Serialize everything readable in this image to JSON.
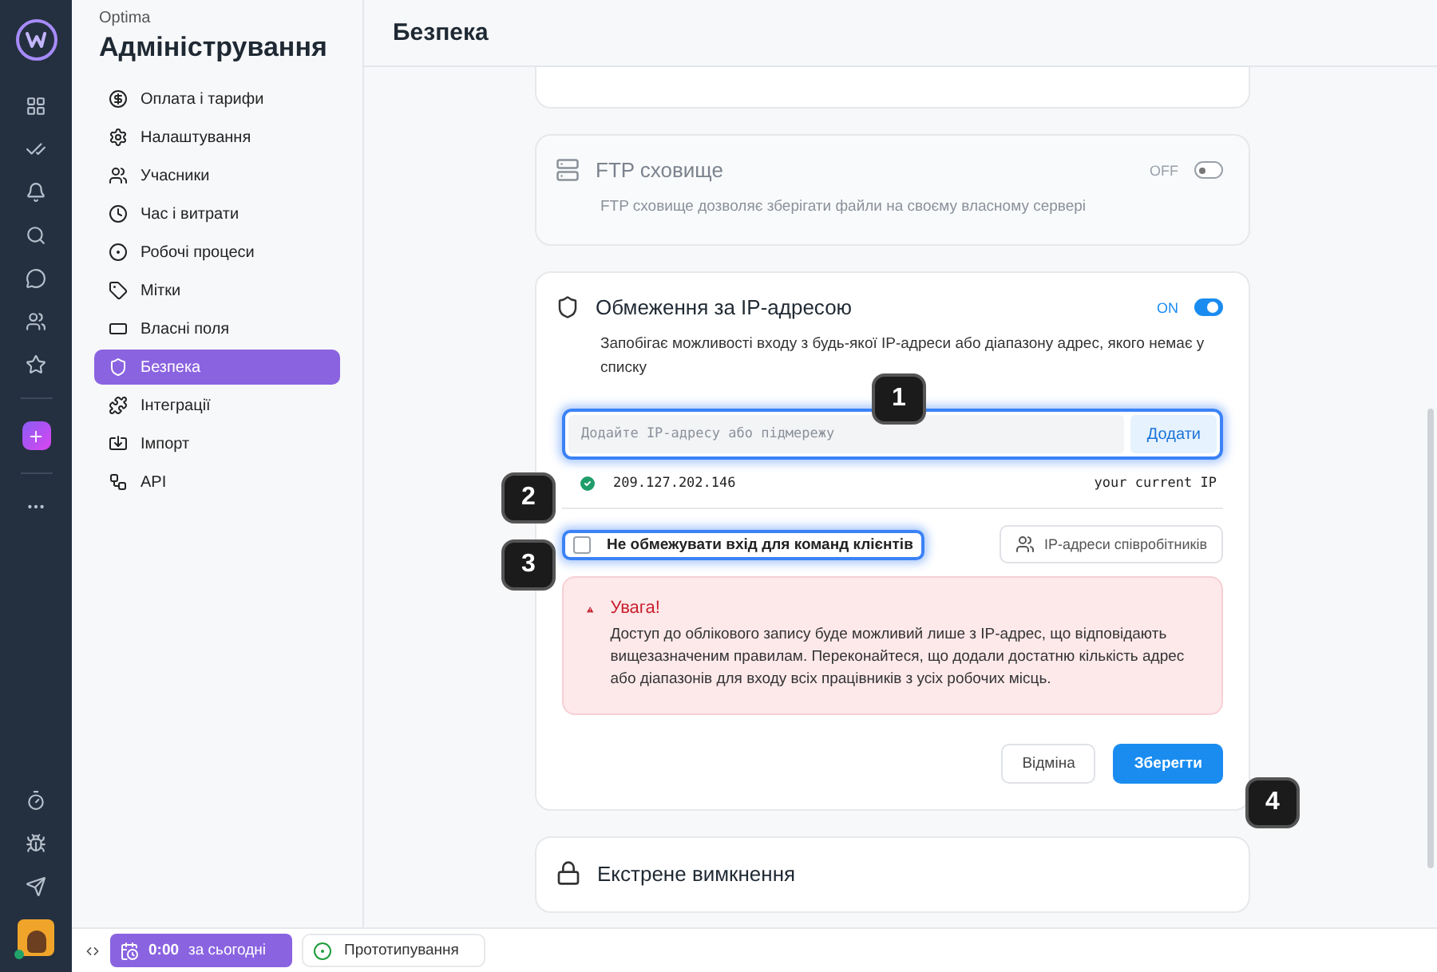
{
  "workspace": {
    "name": "Optima",
    "title": "Адміністрування"
  },
  "sidebar": {
    "items": [
      {
        "label": "Оплата і тарифи",
        "selected": false
      },
      {
        "label": "Налаштування",
        "selected": false
      },
      {
        "label": "Учасники",
        "selected": false
      },
      {
        "label": "Час і витрати",
        "selected": false
      },
      {
        "label": "Робочі процеси",
        "selected": false
      },
      {
        "label": "Мітки",
        "selected": false
      },
      {
        "label": "Власні поля",
        "selected": false
      },
      {
        "label": "Безпека",
        "selected": true
      },
      {
        "label": "Інтеграції",
        "selected": false
      },
      {
        "label": "Імпорт",
        "selected": false
      },
      {
        "label": "API",
        "selected": false
      }
    ]
  },
  "page": {
    "title": "Безпека"
  },
  "ftp": {
    "title": "FTP сховище",
    "toggle_label": "OFF",
    "on": false,
    "description": "FTP сховище дозволяє зберігати файли на своєму власному сервері"
  },
  "ip_restriction": {
    "title": "Обмеження за IP-адресою",
    "toggle_label": "ON",
    "on": true,
    "description": "Запобігає можливості входу з будь-якої IP-адреси або діапазону адрес, якого немає у списку",
    "input": {
      "placeholder": "Додайте IP-адресу або підмережу"
    },
    "add_button": "Додати",
    "addresses": [
      {
        "ip": "209.127.202.146",
        "note": "your current IP"
      }
    ],
    "checkbox": {
      "label": "Не обмежувати вхід для команд клієнтів",
      "checked": false
    },
    "staff_button": "IP-адреси співробітників",
    "warning": {
      "title": "Увага!",
      "text": "Доступ до облікового запису буде можливий лише з IP-адрес, що відповідають вищезазначеним правилам. Переконайтеся, що додали достатню кількість адрес або діапазонів для входу всіх працівників з усіх робочих місць."
    },
    "cancel_button": "Відміна",
    "save_button": "Зберегти"
  },
  "emergency": {
    "title": "Екстрене вимкнення"
  },
  "bottom_bar": {
    "timer": "0:00",
    "timer_label": "за сьогодні",
    "project": "Прототипування"
  },
  "callouts": [
    "1",
    "2",
    "3",
    "4"
  ]
}
